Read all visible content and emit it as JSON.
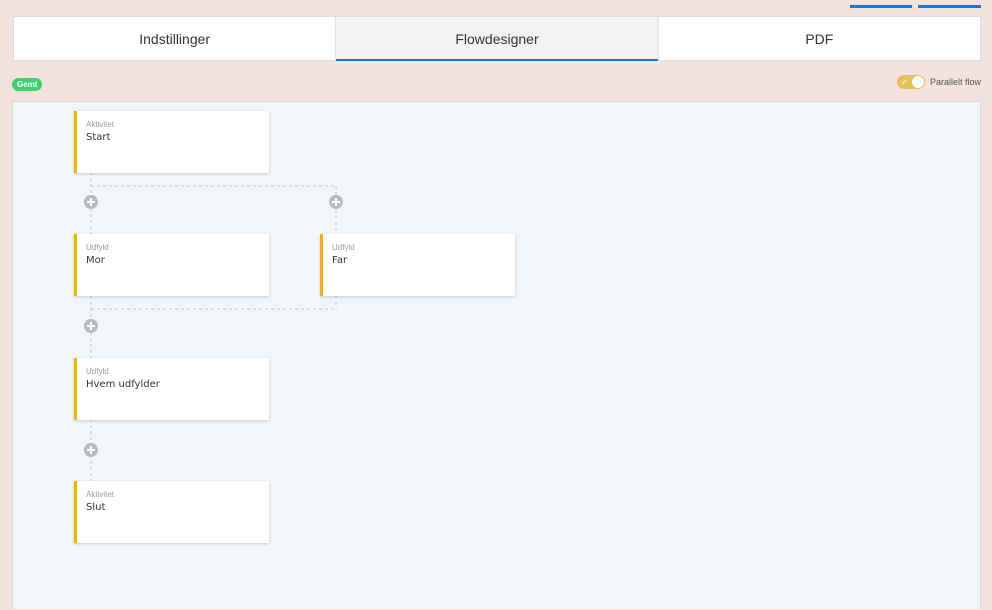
{
  "tabs": [
    {
      "label": "Indstillinger",
      "active": false
    },
    {
      "label": "Flowdesigner",
      "active": true
    },
    {
      "label": "PDF",
      "active": false
    }
  ],
  "status": {
    "saved_label": "Gemt",
    "color": "#3ecf6e"
  },
  "parallel_flow": {
    "label": "Parallelt flow",
    "enabled": true,
    "color": "#e2c25c"
  },
  "accent_color": "#1976d2",
  "node_accent_color": "#ebb12b",
  "nodes": [
    {
      "type": "Aktivitet",
      "label": "Start"
    },
    {
      "type": "Udfyld",
      "label": "Mor"
    },
    {
      "type": "Udfyld",
      "label": "Far"
    },
    {
      "type": "Udfyld",
      "label": "Hvem udfylder"
    },
    {
      "type": "Aktivitet",
      "label": "Slut"
    }
  ],
  "add_buttons": [
    {
      "icon": "plus-circle-icon"
    },
    {
      "icon": "plus-circle-icon"
    },
    {
      "icon": "plus-circle-icon"
    },
    {
      "icon": "plus-circle-icon"
    }
  ]
}
